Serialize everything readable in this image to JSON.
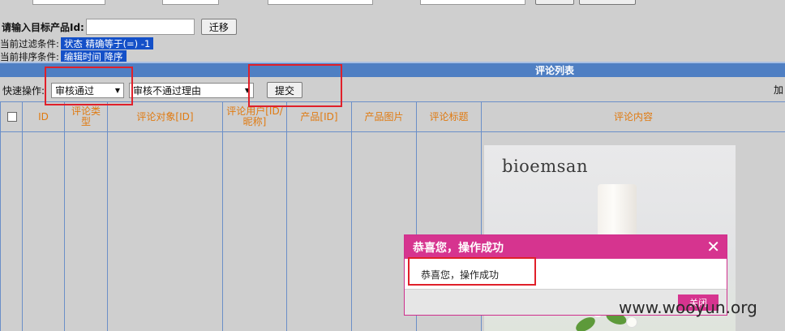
{
  "target": {
    "label": "请输入目标产品Id:",
    "input_value": "",
    "migrate_button": "迁移"
  },
  "filter": {
    "label": "当前过滤条件:",
    "value": "状态 精确等于(=) -1"
  },
  "sort": {
    "label": "当前排序条件:",
    "value": "编辑时间 降序"
  },
  "list": {
    "title": "评论列表"
  },
  "quick_action": {
    "label": "快速操作:",
    "approve_select": "审核通过",
    "reason_select": "审核不通过理由",
    "submit_button": "提交",
    "right_cut_text": "加"
  },
  "table": {
    "headers": [
      "ID",
      "评论类型",
      "评论对象[ID]",
      "评论用户[ID/昵称]",
      "产品[ID]",
      "产品图片",
      "评论标题",
      "评论内容"
    ]
  },
  "product_image": {
    "brand": "bioemsan"
  },
  "dialog": {
    "title": "恭喜您，操作成功",
    "message": "恭喜您，操作成功",
    "close_button": "关闭",
    "close_icon": "close-icon"
  },
  "watermark": "www.wooyun.org",
  "colors": {
    "header_blue": "#4f7fc3",
    "dialog_pink": "#d6348f",
    "highlight_blue": "#1450c8",
    "annotation_red": "#e0202a",
    "column_header_orange": "#e07a10"
  }
}
